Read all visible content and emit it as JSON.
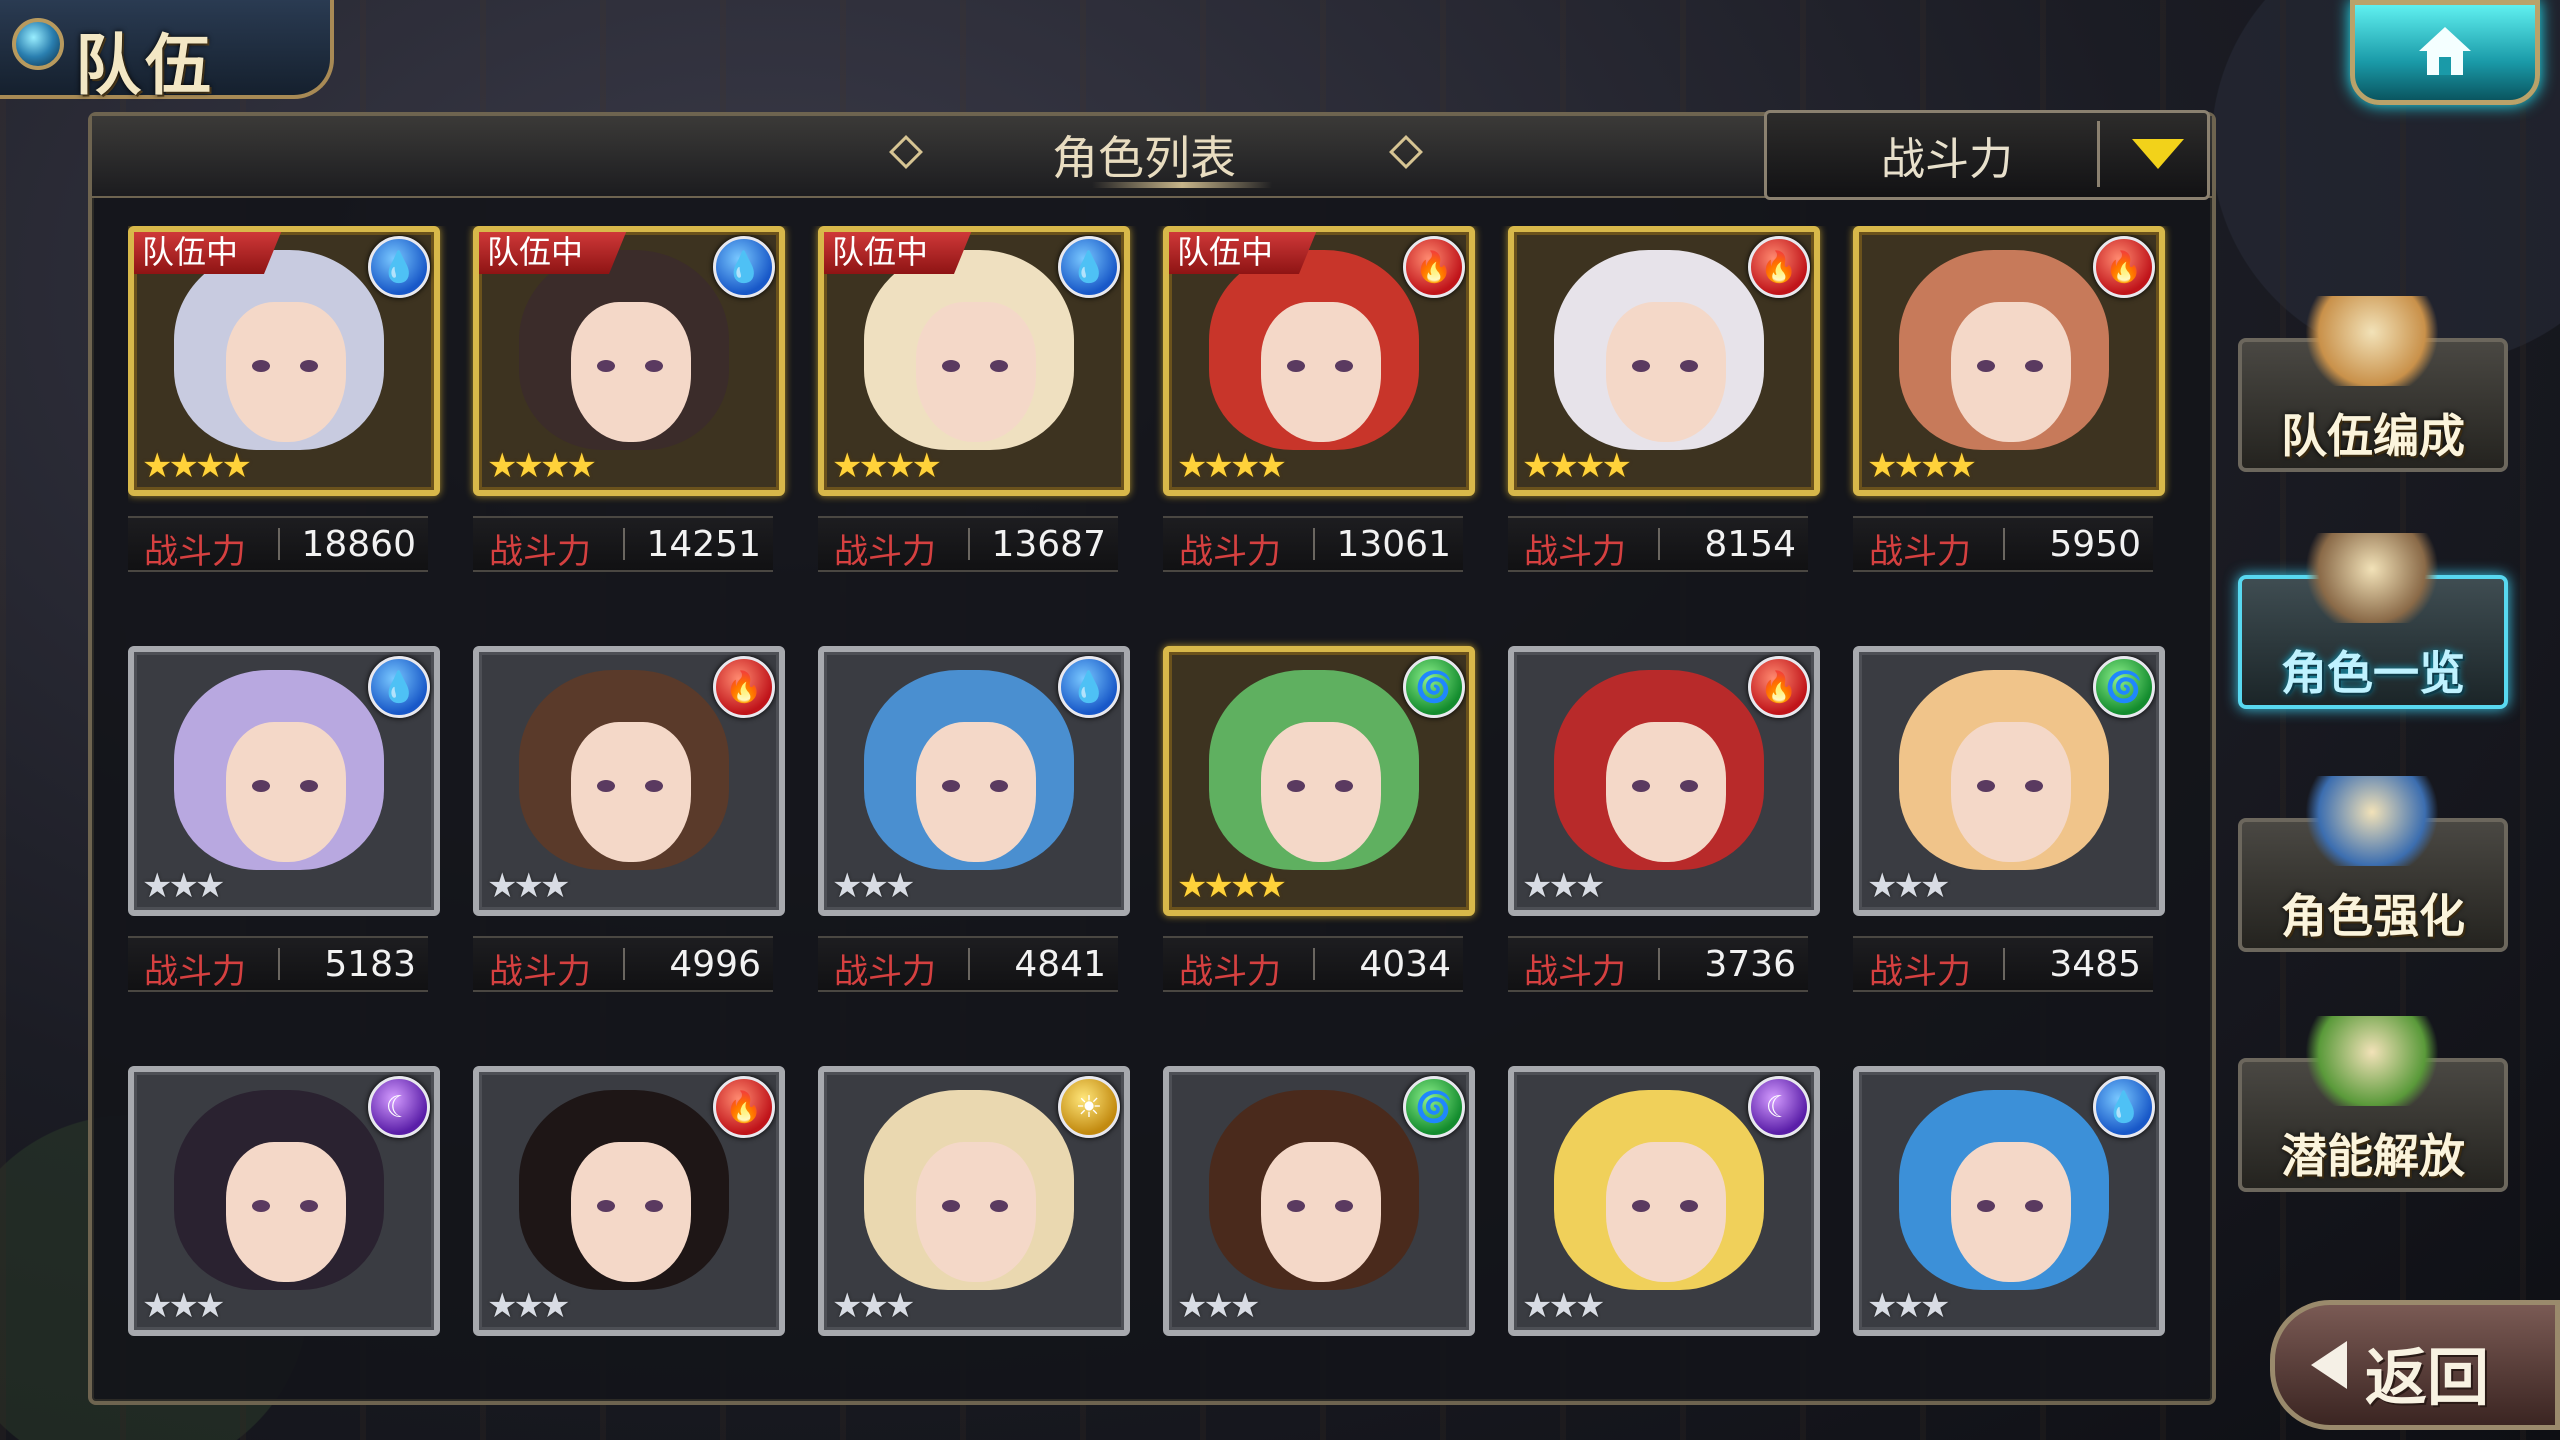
{
  "header": {
    "title": "队伍",
    "home_icon": "home-icon"
  },
  "panel": {
    "title": "角色列表",
    "sort": {
      "selected": "战斗力"
    }
  },
  "power_label": "战斗力",
  "in_team_label": "队伍中",
  "characters": [
    {
      "element": "water",
      "glyph": "💧",
      "rarity": 4,
      "frame": "gold",
      "in_team": true,
      "power": "18860",
      "hair": "#c8cbe0"
    },
    {
      "element": "water",
      "glyph": "💧",
      "rarity": 4,
      "frame": "gold",
      "in_team": true,
      "power": "14251",
      "hair": "#3b2c2a"
    },
    {
      "element": "water",
      "glyph": "💧",
      "rarity": 4,
      "frame": "gold",
      "in_team": true,
      "power": "13687",
      "hair": "#efe0c0"
    },
    {
      "element": "fire",
      "glyph": "🔥",
      "rarity": 4,
      "frame": "gold",
      "in_team": true,
      "power": "13061",
      "hair": "#c8352a"
    },
    {
      "element": "fire",
      "glyph": "🔥",
      "rarity": 4,
      "frame": "gold",
      "in_team": false,
      "power": "8154",
      "hair": "#e7e3ea"
    },
    {
      "element": "fire",
      "glyph": "🔥",
      "rarity": 4,
      "frame": "gold",
      "in_team": false,
      "power": "5950",
      "hair": "#c77a5a"
    },
    {
      "element": "water",
      "glyph": "💧",
      "rarity": 3,
      "frame": "silver",
      "in_team": false,
      "power": "5183",
      "hair": "#b8a8e0"
    },
    {
      "element": "fire",
      "glyph": "🔥",
      "rarity": 3,
      "frame": "silver",
      "in_team": false,
      "power": "4996",
      "hair": "#5a3a2a"
    },
    {
      "element": "water",
      "glyph": "💧",
      "rarity": 3,
      "frame": "silver",
      "in_team": false,
      "power": "4841",
      "hair": "#4a8fd0"
    },
    {
      "element": "wind",
      "glyph": "🌀",
      "rarity": 4,
      "frame": "gold",
      "in_team": false,
      "power": "4034",
      "hair": "#5fb060"
    },
    {
      "element": "fire",
      "glyph": "🔥",
      "rarity": 3,
      "frame": "silver",
      "in_team": false,
      "power": "3736",
      "hair": "#b82a2a"
    },
    {
      "element": "wind",
      "glyph": "🌀",
      "rarity": 3,
      "frame": "silver",
      "in_team": false,
      "power": "3485",
      "hair": "#f0c48a"
    },
    {
      "element": "dark",
      "glyph": "☾",
      "rarity": 3,
      "frame": "silver",
      "in_team": false,
      "power": "",
      "hair": "#2a2230"
    },
    {
      "element": "fire",
      "glyph": "🔥",
      "rarity": 3,
      "frame": "silver",
      "in_team": false,
      "power": "",
      "hair": "#1e1616"
    },
    {
      "element": "light",
      "glyph": "☀",
      "rarity": 3,
      "frame": "silver",
      "in_team": false,
      "power": "",
      "hair": "#ead8b0"
    },
    {
      "element": "wind",
      "glyph": "🌀",
      "rarity": 3,
      "frame": "silver",
      "in_team": false,
      "power": "",
      "hair": "#4a2a1c"
    },
    {
      "element": "dark",
      "glyph": "☾",
      "rarity": 3,
      "frame": "silver",
      "in_team": false,
      "power": "",
      "hair": "#f0d05a"
    },
    {
      "element": "water",
      "glyph": "💧",
      "rarity": 3,
      "frame": "silver",
      "in_team": false,
      "power": "",
      "hair": "#3c90d8"
    }
  ],
  "side_menu": [
    {
      "label": "队伍编成",
      "active": false,
      "art": "#c9914a"
    },
    {
      "label": "角色一览",
      "active": true,
      "art": "#8a6a48"
    },
    {
      "label": "角色强化",
      "active": false,
      "art": "#3c6eb0"
    },
    {
      "label": "潜能解放",
      "active": false,
      "art": "#5a9a3a"
    }
  ],
  "back": {
    "label": "返回"
  }
}
